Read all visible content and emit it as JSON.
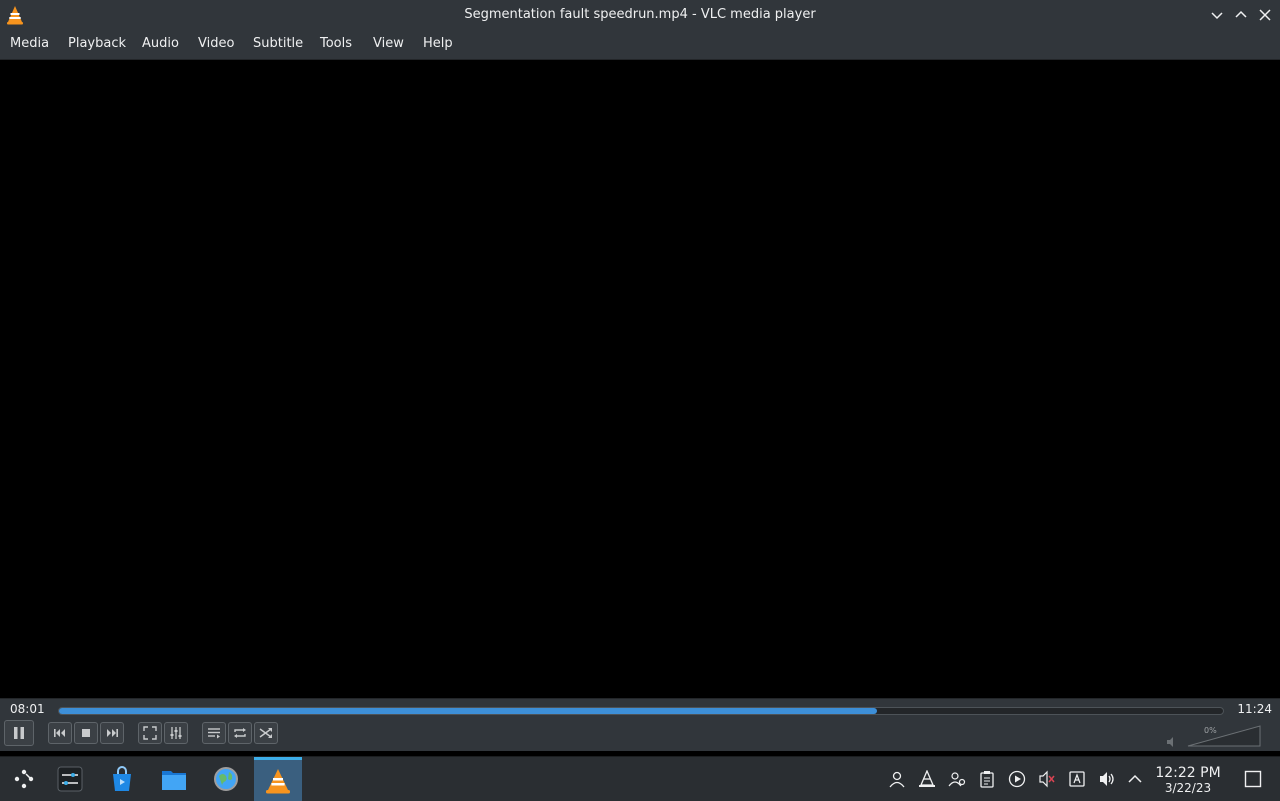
{
  "window": {
    "title": "Segmentation fault speedrun.mp4 - VLC media player"
  },
  "menubar": {
    "items": [
      "Media",
      "Playback",
      "Audio",
      "Video",
      "Subtitle",
      "Tools",
      "View",
      "Help"
    ]
  },
  "player": {
    "elapsed": "08:01",
    "total": "11:24",
    "progress_fraction": 0.703,
    "volume_label": "0%",
    "volume_fraction": 0.0,
    "state": "playing",
    "muted": true
  },
  "taskbar": {
    "clock_time": "12:22 PM",
    "clock_date": "3/22/23",
    "apps": [
      "application-launcher-icon",
      "system-settings-icon",
      "discover-icon",
      "file-manager-icon",
      "browser-icon",
      "vlc-icon"
    ],
    "tray": [
      "user-icon",
      "vlc-tray-icon",
      "accounts-icon",
      "clipboard-icon",
      "media-player-icon",
      "audio-muted-icon",
      "input-method-icon",
      "volume-icon",
      "expand-tray-icon"
    ]
  },
  "colors": {
    "accent": "#3d8fd8",
    "panel": "#31363b",
    "taskbar": "#2a2e32",
    "vlc_orange": "#f7941e"
  }
}
